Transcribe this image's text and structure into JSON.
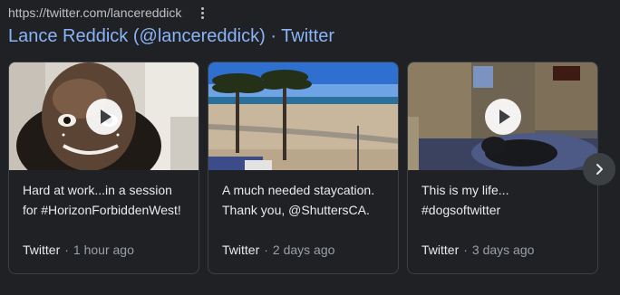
{
  "result": {
    "url": "https://twitter.com/lancereddick",
    "title": "Lance Reddick (@lancereddick) · Twitter"
  },
  "cards": [
    {
      "text_line1": "Hard at work...in a session",
      "text_line2": "for #HorizonForbiddenWest!",
      "source": "Twitter",
      "time": "1 hour ago"
    },
    {
      "text_line1": "A much needed staycation.",
      "text_line2": "Thank you, @ShuttersCA.",
      "source": "Twitter",
      "time": "2 days ago"
    },
    {
      "text_line1": "This is my life...",
      "text_line2": "#dogsoftwitter",
      "source": "Twitter",
      "time": "3 days ago"
    }
  ],
  "separator": "·",
  "icons": {
    "more": "more-vert-icon",
    "play": "play-icon",
    "next": "chevron-right-icon"
  },
  "colors": {
    "background": "#202124",
    "link": "#8ab4f8",
    "text": "#e8eaed",
    "muted": "#9aa0a6",
    "border": "#3c4043"
  }
}
